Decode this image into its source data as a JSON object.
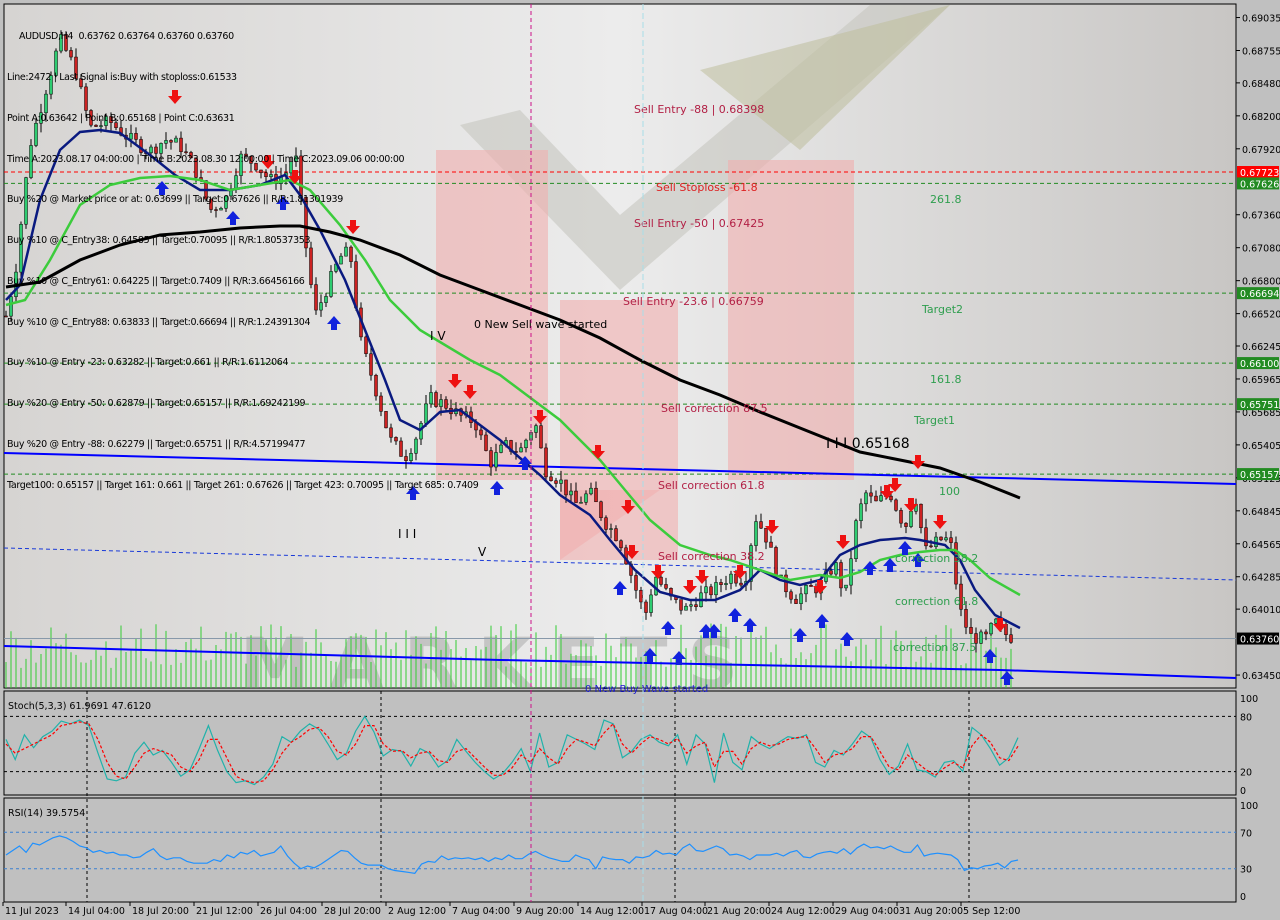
{
  "header": {
    "symbol_line": "AUDUSD,H4  0.63762 0.63764 0.63760 0.63760",
    "info_lines": [
      "Line:2472 | Last Signal is:Buy with stoploss:0.61533",
      "Point A:0.63642 | Point B:0.65168 | Point C:0.63631",
      "Time A:2023.08.17 04:00:00 | Time B:2023.08.30 12:00:00 | Time C:2023.09.06 00:00:00",
      "Buy %20 @ Market price or at: 0.63699 || Target:0.67626 || R/R:1.81301939",
      "Buy %10 @ C_Entry38: 0.64585 || Target:0.70095 || R/R:1.80537353",
      "Buy %10 @ C_Entry61: 0.64225 || Target:0.7409 || R/R:3.66456166",
      "Buy %10 @ C_Entry88: 0.63833 || Target:0.66694 || R/R:1.24391304",
      "Buy %10 @ Entry -23: 0.63282 || Target:0.661 || R/R:1.6112064",
      "Buy %20 @ Entry -50: 0.62879 || Target:0.65157 || R/R:1.69242199",
      "Buy %20 @ Entry -88: 0.62279 || Target:0.65751 || R/R:4.57199477",
      "Target100: 0.65157 || Target 161: 0.661 || Target 261: 0.67626 || Target 423: 0.70095 || Target 685: 0.7409"
    ]
  },
  "chart_data": [
    {
      "type": "candlestick",
      "title": "AUDUSD,H4",
      "ohlc_current": {
        "open": 0.63762,
        "high": 0.63764,
        "low": 0.6376,
        "close": 0.6376
      },
      "ylim": [
        0.6334,
        0.6915
      ],
      "y_ticks": [
        "0.69035",
        "0.68755",
        "0.68480",
        "0.68200",
        "0.67920",
        "0.67360",
        "0.67080",
        "0.66800",
        "0.66520",
        "0.66245",
        "0.65965",
        "0.65685",
        "0.65405",
        "0.65125",
        "0.64845",
        "0.64565",
        "0.64285",
        "0.64010",
        "0.63450"
      ],
      "x_ticks": [
        "11 Jul 2023",
        "14 Jul 04:00",
        "18 Jul 20:00",
        "21 Jul 12:00",
        "26 Jul 04:00",
        "28 Jul 20:00",
        "2 Aug 12:00",
        "7 Aug 04:00",
        "9 Aug 20:00",
        "14 Aug 12:00",
        "17 Aug 04:00",
        "21 Aug 20:00",
        "24 Aug 12:00",
        "29 Aug 04:00",
        "31 Aug 20:00",
        "5 Sep 12:00"
      ],
      "price_tags": [
        {
          "value": "0.67723",
          "price": 0.67723,
          "bg": "#ff0000",
          "line": "#ff0000"
        },
        {
          "value": "0.67626",
          "price": 0.67626,
          "bg": "#228b22",
          "line": "#228b22"
        },
        {
          "value": "0.66694",
          "price": 0.66694,
          "bg": "#228b22",
          "line": "#228b22"
        },
        {
          "value": "0.66100",
          "price": 0.661,
          "bg": "#228b22",
          "line": "#228b22"
        },
        {
          "value": "0.65751",
          "price": 0.65751,
          "bg": "#228b22",
          "line": "#228b22"
        },
        {
          "value": "0.65157",
          "price": 0.65157,
          "bg": "#228b22",
          "line": "#228b22"
        },
        {
          "value": "0.63760",
          "price": 0.6376,
          "bg": "#000000",
          "line": "#8899aa"
        }
      ],
      "level_labels": [
        {
          "text": "Sell Entry -88 | 0.68398",
          "price": 0.68398,
          "color": "#b22045"
        },
        {
          "text": "Sell Stoploss -61.8",
          "price": 0.6772,
          "color": "#dd2020"
        },
        {
          "text": "Sell Entry -50 | 0.67425",
          "price": 0.67425,
          "color": "#b22045"
        },
        {
          "text": "Sell Entry -23.6 | 0.66759",
          "price": 0.66759,
          "color": "#b22045"
        },
        {
          "text": "Sell correction 87.5",
          "price": 0.6575,
          "color": "#b22045"
        },
        {
          "text": "Sell correction 61.8",
          "price": 0.6515,
          "color": "#b22045"
        },
        {
          "text": "Sell correction 38.2",
          "price": 0.6457,
          "color": "#b22045"
        },
        {
          "text": "261.8",
          "price": 0.6759,
          "color": "#2e9e4e"
        },
        {
          "text": "Target2",
          "price": 0.6661,
          "color": "#2e9e4e"
        },
        {
          "text": "161.8",
          "price": 0.6607,
          "color": "#2e9e4e"
        },
        {
          "text": "Target1",
          "price": 0.6572,
          "color": "#2e9e4e"
        },
        {
          "text": "100",
          "price": 0.6512,
          "color": "#2e9e4e"
        },
        {
          "text": "correction 38.2",
          "price": 0.6455,
          "color": "#2e9e4e"
        },
        {
          "text": "correction 61.8",
          "price": 0.6419,
          "color": "#2e9e4e"
        },
        {
          "text": "correction 87.5",
          "price": 0.6382,
          "color": "#2e9e4e"
        }
      ],
      "wave_labels": [
        {
          "text": "0 New Sell wave started",
          "color": "#000000"
        },
        {
          "text": "I V",
          "color": "#000000"
        },
        {
          "text": "I I I",
          "color": "#000000"
        },
        {
          "text": "V",
          "color": "#000000"
        },
        {
          "text": "I I I 0.65168",
          "color": "#000000"
        },
        {
          "text": "0 New Buy Wave started",
          "color": "#1a1acc"
        }
      ],
      "series": [
        {
          "name": "MA fast (navy)",
          "color": "#0a1a80"
        },
        {
          "name": "MA mid (green)",
          "color": "#3ccc3c"
        },
        {
          "name": "MA slow (black)",
          "color": "#000000"
        },
        {
          "name": "Trendline (blue)",
          "color": "#0000ff"
        }
      ]
    },
    {
      "type": "line",
      "title": "Stoch(5,3,3) 61.9691 47.6120",
      "main_value": 61.9691,
      "signal_value": 47.612,
      "ylim": [
        0,
        100
      ],
      "y_ticks": [
        "100",
        "80",
        "20",
        "0"
      ],
      "levels": [
        80,
        20
      ],
      "series": [
        {
          "name": "%K",
          "color": "#20b2aa",
          "values": [
            55,
            33,
            60,
            46,
            58,
            64,
            75,
            72,
            76,
            70,
            40,
            12,
            10,
            14,
            40,
            52,
            38,
            43,
            30,
            15,
            22,
            45,
            70,
            43,
            20,
            8,
            10,
            6,
            14,
            28,
            58,
            52,
            64,
            72,
            66,
            50,
            33,
            40,
            64,
            80,
            63,
            37,
            44,
            42,
            26,
            45,
            40,
            25,
            32,
            55,
            42,
            30,
            20,
            12,
            18,
            30,
            45,
            20,
            62,
            25,
            30,
            60,
            55,
            50,
            44,
            76,
            72,
            35,
            42,
            55,
            60,
            52,
            48,
            60,
            28,
            60,
            50,
            8,
            62,
            30,
            22,
            58,
            50,
            45,
            52,
            58,
            56,
            60,
            30,
            25,
            43,
            38,
            50,
            64,
            57,
            33,
            17,
            26,
            50,
            22,
            20,
            14,
            30,
            32,
            20,
            68,
            60,
            45,
            27,
            35,
            57
          ]
        },
        {
          "name": "%D",
          "color": "#ff0000",
          "values": [
            50,
            40,
            45,
            50,
            55,
            60,
            70,
            72,
            74,
            72,
            55,
            30,
            15,
            12,
            25,
            40,
            45,
            42,
            38,
            25,
            20,
            33,
            55,
            55,
            35,
            15,
            10,
            8,
            10,
            22,
            40,
            52,
            58,
            66,
            68,
            58,
            42,
            38,
            50,
            70,
            70,
            50,
            42,
            43,
            35,
            40,
            42,
            32,
            30,
            42,
            45,
            35,
            25,
            16,
            16,
            24,
            38,
            30,
            45,
            35,
            28,
            45,
            55,
            52,
            48,
            62,
            72,
            50,
            40,
            50,
            58,
            55,
            50,
            56,
            40,
            48,
            52,
            25,
            42,
            42,
            28,
            45,
            52,
            48,
            50,
            55,
            57,
            58,
            45,
            30,
            38,
            40,
            45,
            58,
            58,
            42,
            25,
            22,
            38,
            30,
            22,
            16,
            24,
            30,
            24,
            48,
            60,
            52,
            35,
            32,
            47.6
          ]
        }
      ]
    },
    {
      "type": "line",
      "title": "RSI(14) 39.5754",
      "value": 39.5754,
      "ylim": [
        0,
        100
      ],
      "y_ticks": [
        "100",
        "70",
        "30",
        "0"
      ],
      "levels": [
        70,
        30
      ],
      "series": [
        {
          "name": "RSI",
          "color": "#1e90ff",
          "values": [
            45,
            50,
            55,
            48,
            58,
            56,
            60,
            64,
            66,
            64,
            60,
            55,
            53,
            48,
            50,
            47,
            48,
            45,
            45,
            42,
            43,
            48,
            52,
            44,
            40,
            42,
            42,
            38,
            36,
            36,
            36,
            40,
            38,
            45,
            42,
            48,
            46,
            50,
            44,
            46,
            48,
            55,
            44,
            36,
            30,
            33,
            31,
            35,
            40,
            45,
            50,
            49,
            42,
            36,
            34,
            34,
            34,
            30,
            28,
            27,
            26,
            25,
            35,
            38,
            37,
            44,
            40,
            42,
            41,
            42,
            40,
            42,
            38,
            42,
            40,
            45,
            41,
            41,
            46,
            49,
            45,
            42,
            40,
            38,
            38,
            45,
            42,
            40,
            30,
            43,
            41,
            40,
            40,
            36,
            43,
            42,
            44,
            50,
            46,
            47,
            45,
            53,
            57,
            50,
            49,
            52,
            55,
            52,
            45,
            46,
            44,
            40,
            45,
            45,
            45,
            47,
            44,
            48,
            50,
            43,
            42,
            46,
            48,
            49,
            47,
            52,
            46,
            53,
            57,
            53,
            54,
            52,
            55,
            51,
            48,
            48,
            56,
            44,
            46,
            47,
            46,
            45,
            40,
            28,
            31,
            30,
            33,
            34,
            36,
            31,
            38,
            39.6
          ]
        }
      ]
    }
  ]
}
